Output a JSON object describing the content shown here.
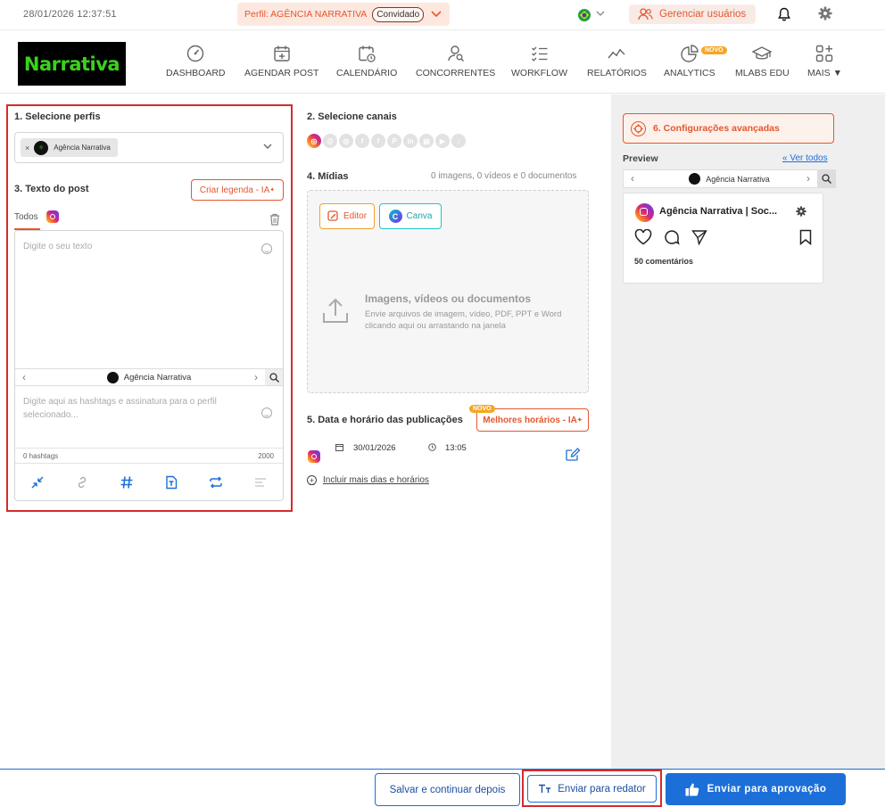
{
  "topbar": {
    "datetime": "28/01/2026   12:37:51",
    "profile_label": "Perfil: AGÊNCIA NARRATIVA",
    "guest_badge": "Convidado",
    "manage_users": "Gerenciar usuários"
  },
  "logo": {
    "text": "Narrativa"
  },
  "nav": {
    "items": [
      {
        "label": "DASHBOARD",
        "icon": "gauge-icon"
      },
      {
        "label": "AGENDAR POST",
        "icon": "calendar-plus-icon"
      },
      {
        "label": "CALENDÁRIO",
        "icon": "calendar-clock-icon"
      },
      {
        "label": "CONCORRENTES",
        "icon": "user-search-icon"
      },
      {
        "label": "WORKFLOW",
        "icon": "checklist-icon"
      },
      {
        "label": "RELATÓRIOS",
        "icon": "line-chart-icon"
      },
      {
        "label": "ANALYTICS",
        "icon": "pie-chart-icon"
      },
      {
        "label": "MLABS EDU",
        "icon": "graduation-cap-icon"
      },
      {
        "label": "MAIS ▼",
        "icon": "apps-icon"
      }
    ],
    "analytics_badge": "NOVO"
  },
  "profiles": {
    "title": "1. Selecione perfis",
    "selected_chip": "Agência Narrativa",
    "chip_remove": "×"
  },
  "post_text": {
    "title": "3. Texto do post",
    "ai_caption_button": "Criar legenda - IA",
    "ai_sup": "✦",
    "tab_all": "Todos",
    "text_placeholder": "Digite o seu texto",
    "profile_nav_name": "Agência Narrativa",
    "hashtags_placeholder": "Digite aqui as hashtags e assinatura para o perfil selecionado...",
    "hashtag_count": "0 hashtags",
    "char_limit": "2000"
  },
  "channels": {
    "title": "2. Selecione canais",
    "list": [
      "instagram",
      "threads",
      "instagram-stories",
      "facebook",
      "facebook-group",
      "pinterest",
      "linkedin",
      "gmb",
      "youtube",
      "tiktok"
    ]
  },
  "media": {
    "title": "4. Mídias",
    "count": "0 imagens, 0 vídeos e 0 documentos",
    "editor_button": "Editor",
    "canva_button": "Canva",
    "drop_title": "Imagens, vídeos ou documentos",
    "drop_subtitle": "Envie arquivos de imagem, vídeo, PDF, PPT e Word clicando aqui ou arrastando na janela"
  },
  "schedule": {
    "title": "5. Data e horário das publicações",
    "best_times_button": "Melhores horários - IA",
    "best_times_badge": "NOVO",
    "date": "30/01/2026",
    "time": "13:05",
    "add_more": "Incluir mais dias e horários"
  },
  "advanced": {
    "button": "6. Configurações avançadas"
  },
  "preview": {
    "label": "Preview",
    "see_all": "Ver todos",
    "see_all_arrow": "«",
    "nav_name": "Agência Narrativa",
    "card_name": "Agência Narrativa | Soc...",
    "comments": "50 comentários"
  },
  "footer": {
    "save_button": "Salvar e continuar depois",
    "redator_button": "Enviar para redator",
    "approve_button": "Enviar para aprovação"
  },
  "colors": {
    "accent_orange": "#e4572e",
    "primary_blue": "#1c6fd8",
    "highlight_red": "#d52b2b",
    "logo_green": "#39d31a"
  }
}
